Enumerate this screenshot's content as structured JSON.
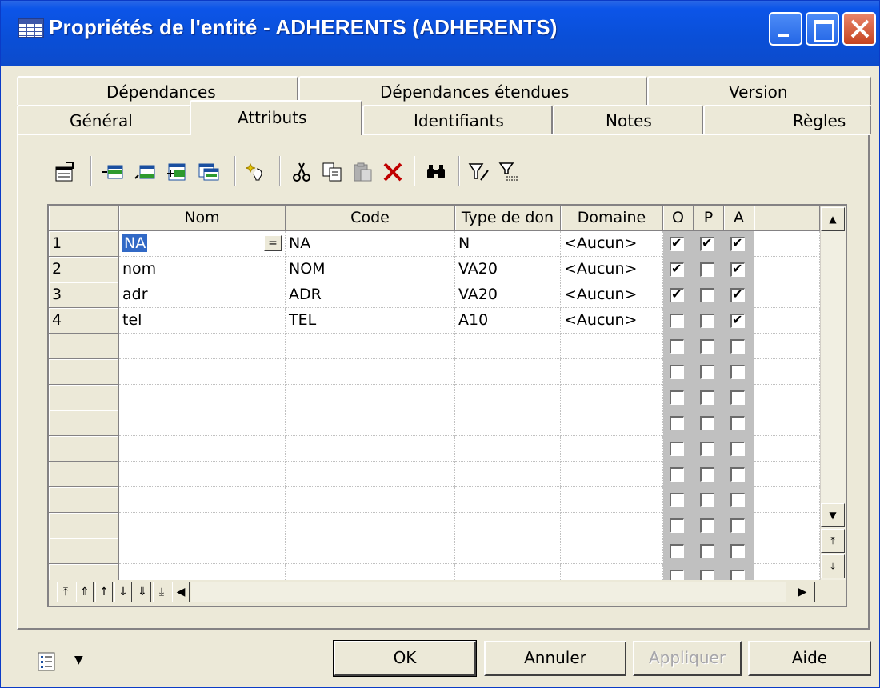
{
  "window": {
    "title": "Propriétés de l'entité - ADHERENTS (ADHERENTS)",
    "colors": {
      "titlebar": "#0a4fd8",
      "face": "#ece9d8",
      "close": "#c54421",
      "selection": "#3169c6"
    }
  },
  "tabs": {
    "row_back": [
      "Dépendances",
      "Dépendances étendues",
      "Version"
    ],
    "row_front": [
      "Général",
      "Attributs",
      "Identifiants",
      "Notes",
      "Règles"
    ],
    "active": "Attributs"
  },
  "toolbar": {
    "icons": [
      "properties-icon",
      "insert-row-icon",
      "add-row-icon",
      "add-rows-icon",
      "reuse-columns-icon",
      "wizard-icon",
      "cut-icon",
      "copy-icon",
      "paste-icon",
      "delete-icon",
      "find-icon",
      "filter-icon",
      "filter-clear-icon"
    ]
  },
  "grid": {
    "columns": [
      "Nom",
      "Code",
      "Type de don",
      "Domaine",
      "O",
      "P",
      "A"
    ],
    "rows": [
      {
        "num": "1",
        "nom": "NA",
        "code": "NA",
        "type": "N",
        "domaine": "<Aucun>",
        "o": true,
        "p": true,
        "a": true
      },
      {
        "num": "2",
        "nom": "nom",
        "code": "NOM",
        "type": "VA20",
        "domaine": "<Aucun>",
        "o": true,
        "p": false,
        "a": true
      },
      {
        "num": "3",
        "nom": "adr",
        "code": "ADR",
        "type": "VA20",
        "domaine": "<Aucun>",
        "o": true,
        "p": false,
        "a": true
      },
      {
        "num": "4",
        "nom": "tel",
        "code": "TEL",
        "type": "A10",
        "domaine": "<Aucun>",
        "o": false,
        "p": false,
        "a": true
      }
    ],
    "empty_rows": 10,
    "selected_cell": "NA",
    "ellipsis_button": "="
  },
  "buttons": {
    "ok": "OK",
    "cancel": "Annuler",
    "apply": "Appliquer",
    "help": "Aide"
  }
}
